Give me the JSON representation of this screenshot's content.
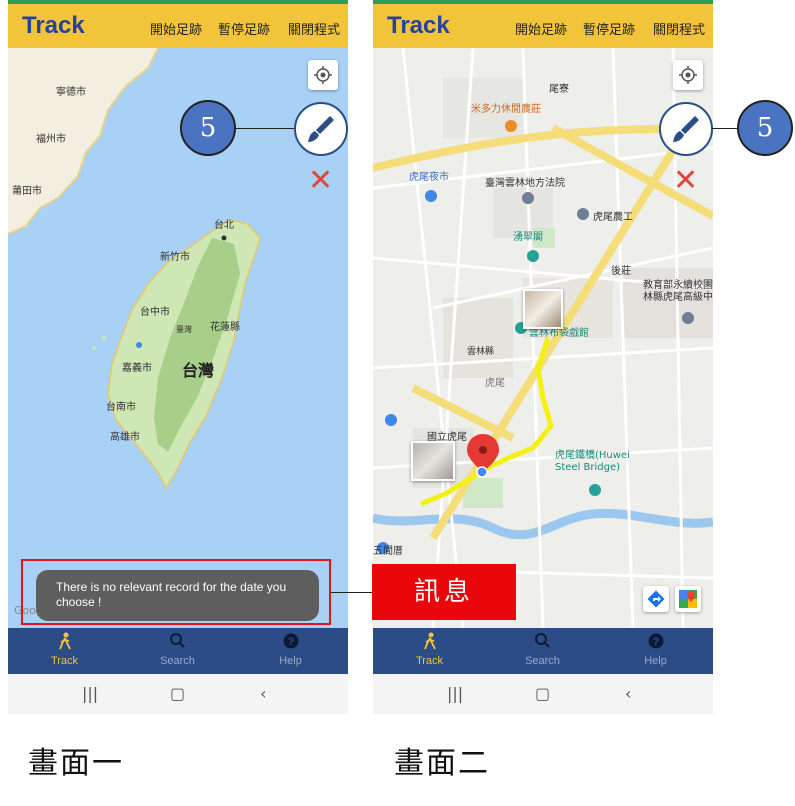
{
  "screens": [
    {
      "app_title": "Track",
      "menu": [
        "開始足跡",
        "暫停足跡",
        "關閉程式"
      ],
      "map_labels": {
        "ningde": "寧德市",
        "fuzhou": "福州市",
        "putian": "莆田市",
        "taipei": "台北",
        "hsinchu": "新竹市",
        "taichung": "台中市",
        "taiwan_small": "臺灣",
        "hualien": "花蓮縣",
        "chiayi": "嘉義市",
        "taiwan": "台灣",
        "tainan": "台南市",
        "kaohsiung": "高雄市"
      },
      "toast": "There is no relevant record for the date you choose !",
      "nav": [
        {
          "label": "Track",
          "icon": "walk-icon"
        },
        {
          "label": "Search",
          "icon": "search-icon"
        },
        {
          "label": "Help",
          "icon": "help-icon"
        }
      ]
    },
    {
      "app_title": "Track",
      "menu": [
        "開始足跡",
        "暫停足跡",
        "關閉程式"
      ],
      "map_labels": {
        "weiliao": "尾寮",
        "restaurant": "米多力休閒農莊",
        "night_market": "虎尾夜市",
        "court": "臺灣雲林地方法院",
        "farm": "虎尾農工",
        "yongcuige": "湧翠閣",
        "houzhuang": "後莊",
        "school": "教育部永續校園\n林縣虎尾高級中",
        "museum": "雲林布袋戲館",
        "yunlin": "雲林縣",
        "huwei": "虎尾",
        "university": "國立虎尾\n大學",
        "bridge": "虎尾鐵橋(Huwei\nSteel Bridge)",
        "wujianlu": "五間厝"
      },
      "nav": [
        {
          "label": "Track",
          "icon": "walk-icon"
        },
        {
          "label": "Search",
          "icon": "search-icon"
        },
        {
          "label": "Help",
          "icon": "help-icon"
        }
      ]
    }
  ],
  "annotations": {
    "callout_number": "5",
    "message_label": "訊息",
    "caption_1": "畫面一",
    "caption_2": "畫面二"
  },
  "colors": {
    "appbar": "#f1c43a",
    "title": "#25439a",
    "navbar": "#2b4c86",
    "callout": "#4a74c1",
    "message_label": "#e9070c"
  }
}
